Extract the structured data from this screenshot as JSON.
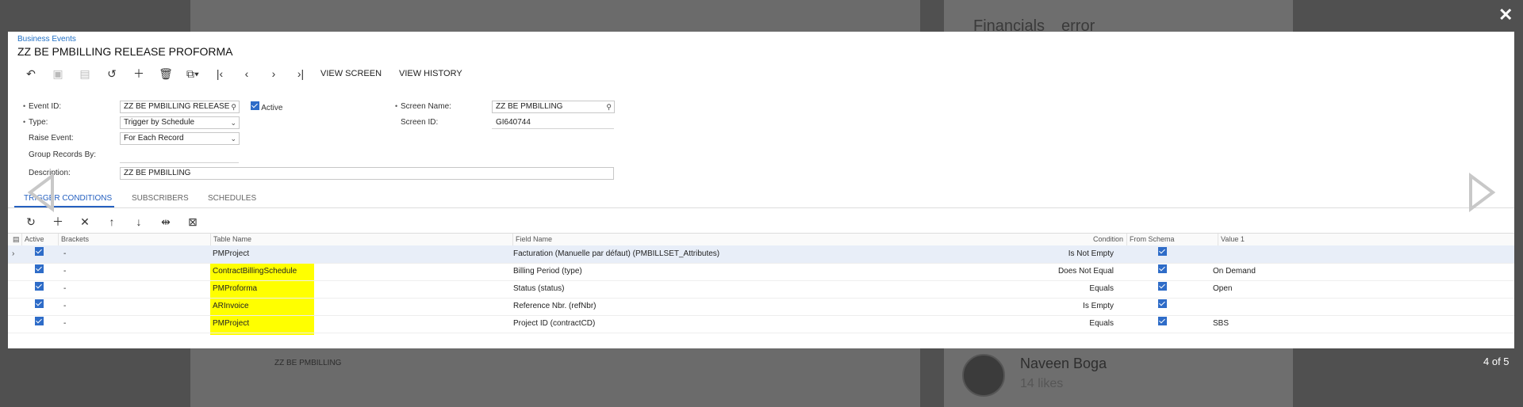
{
  "background": {
    "financials": "Financials",
    "error": "error",
    "bottom_title": "ZZ BE PMBILLING",
    "user_name": "Naveen Boga",
    "user_likes": "14 likes"
  },
  "lightbox": {
    "close_icon": "close-icon",
    "counter": "4 of 5"
  },
  "page": {
    "breadcrumb": "Business Events",
    "title": "ZZ BE PMBILLING RELEASE PROFORMA"
  },
  "toolbar": {
    "view_screen": "VIEW SCREEN",
    "view_history": "VIEW HISTORY"
  },
  "form": {
    "event_id_label": "Event ID:",
    "event_id_value": "ZZ BE PMBILLING RELEASE",
    "active_label": "Active",
    "type_label": "Type:",
    "type_value": "Trigger by Schedule",
    "raise_event_label": "Raise Event:",
    "raise_event_value": "For Each Record",
    "group_records_label": "Group Records By:",
    "description_label": "Description:",
    "description_value": "ZZ BE PMBILLING",
    "screen_name_label": "Screen Name:",
    "screen_name_value": "ZZ BE PMBILLING",
    "screen_id_label": "Screen ID:",
    "screen_id_value": "GI640744"
  },
  "tabs": {
    "trigger_conditions": "TRIGGER CONDITIONS",
    "subscribers": "SUBSCRIBERS",
    "schedules": "SCHEDULES"
  },
  "grid": {
    "headers": {
      "active": "Active",
      "brackets": "Brackets",
      "table_name": "Table Name",
      "field_name": "Field Name",
      "condition": "Condition",
      "from_schema": "From Schema",
      "value1": "Value 1"
    },
    "rows": [
      {
        "brackets": "-",
        "table": "PMProject",
        "field": "Facturation (Manuelle par défaut) (PMBILLSET_Attributes)",
        "condition": "Is Not Empty",
        "value1": ""
      },
      {
        "brackets": "-",
        "table": "ContractBillingSchedule",
        "field": "Billing Period (type)",
        "condition": "Does Not Equal",
        "value1": "On Demand"
      },
      {
        "brackets": "-",
        "table": "PMProforma",
        "field": "Status (status)",
        "condition": "Equals",
        "value1": "Open"
      },
      {
        "brackets": "-",
        "table": "ARInvoice",
        "field": "Reference Nbr. (refNbr)",
        "condition": "Is Empty",
        "value1": ""
      },
      {
        "brackets": "-",
        "table": "PMProject",
        "field": "Project ID (contractCD)",
        "condition": "Equals",
        "value1": "SBS"
      }
    ]
  },
  "colors": {
    "accent": "#2560c0",
    "highlight": "#ffff00",
    "link": "#1f6fc5"
  }
}
